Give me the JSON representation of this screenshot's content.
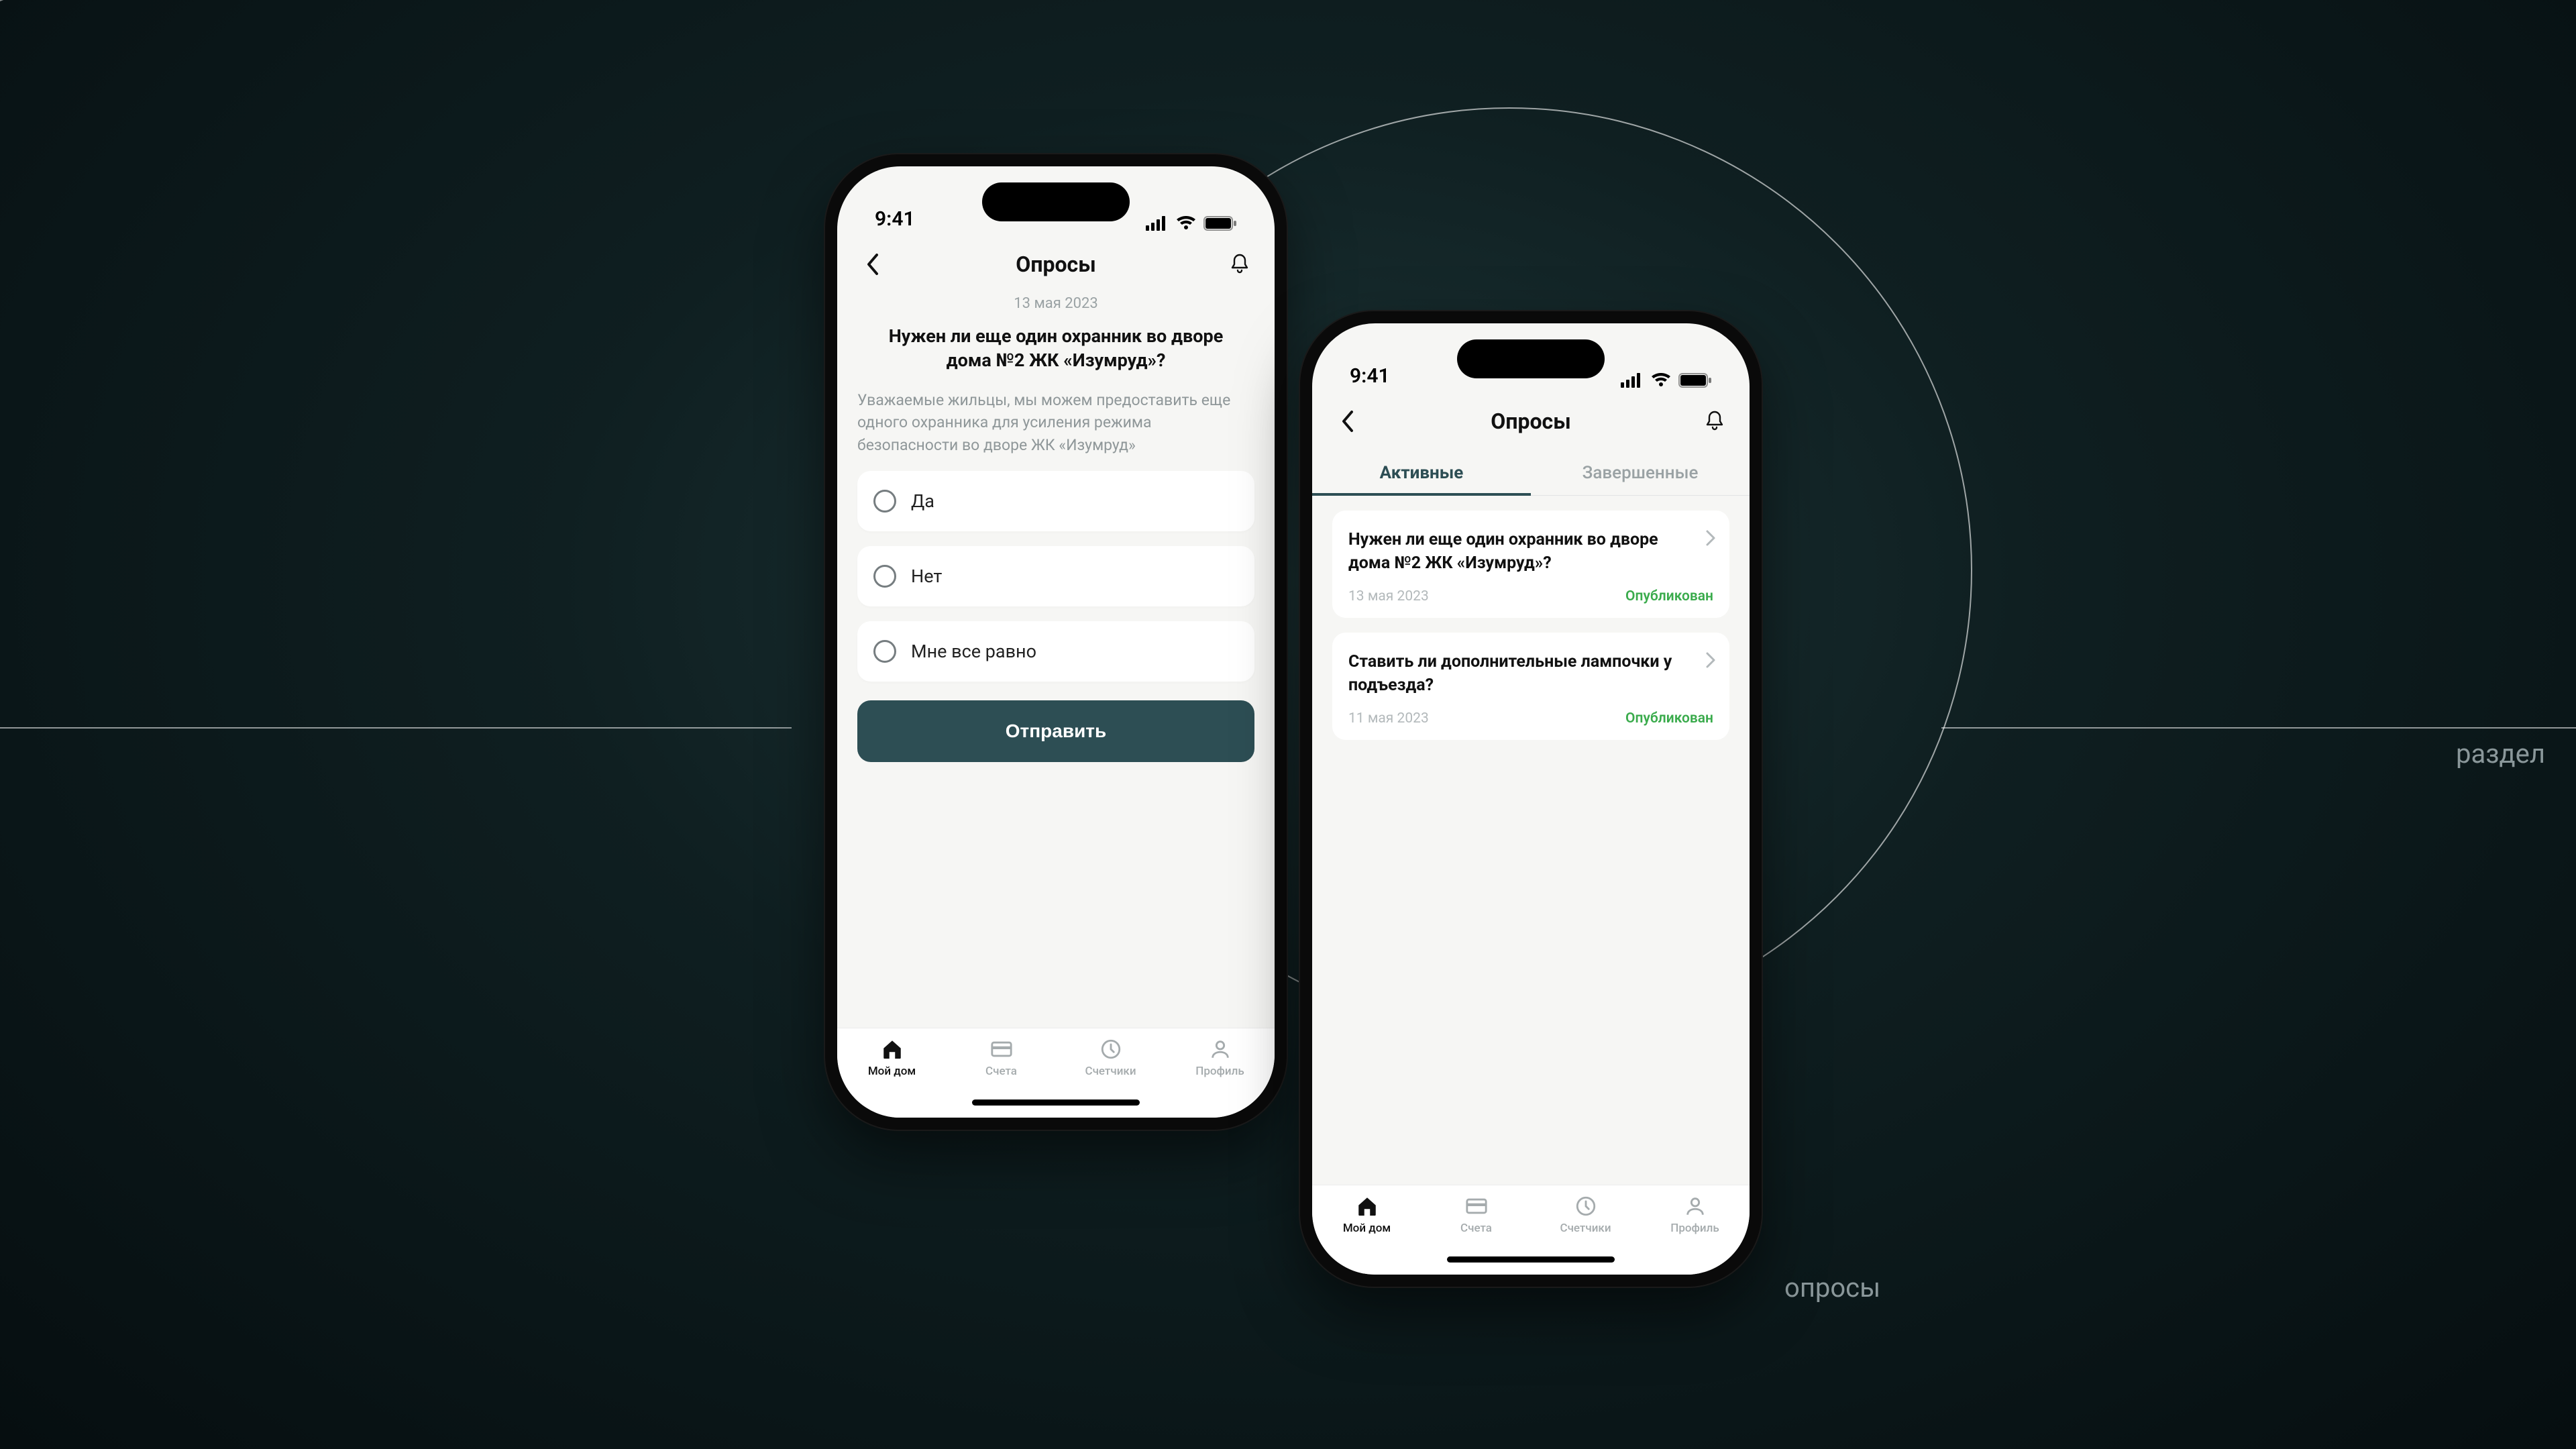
{
  "sideLabels": {
    "section": "раздел",
    "polls": "опросы"
  },
  "statusTime": "9:41",
  "phone1": {
    "navTitle": "Опросы",
    "date": "13 мая 2023",
    "question": "Нужен ли еще один охранник во дворе дома №2 ЖК «Изумруд»?",
    "description": "Уважаемые жильцы, мы можем предоставить еще одного охранника для усиления режима безопасности во дворе ЖК  «Изумруд»",
    "options": [
      "Да",
      "Нет",
      "Мне все равно"
    ],
    "submitLabel": "Отправить"
  },
  "phone2": {
    "navTitle": "Опросы",
    "tabs": {
      "active": "Активные",
      "completed": "Завершенные"
    },
    "polls": [
      {
        "title": "Нужен ли еще один охранник во дворе дома №2 ЖК «Изумруд»?",
        "date": "13 мая 2023",
        "status": "Опубликован"
      },
      {
        "title": "Ставить ли дополнительные лампочки у подъезда?",
        "date": "11 мая 2023",
        "status": "Опубликован"
      }
    ]
  },
  "tabbar": {
    "items": [
      {
        "label": "Мой дом"
      },
      {
        "label": "Счета"
      },
      {
        "label": "Счетчики"
      },
      {
        "label": "Профиль"
      }
    ]
  }
}
